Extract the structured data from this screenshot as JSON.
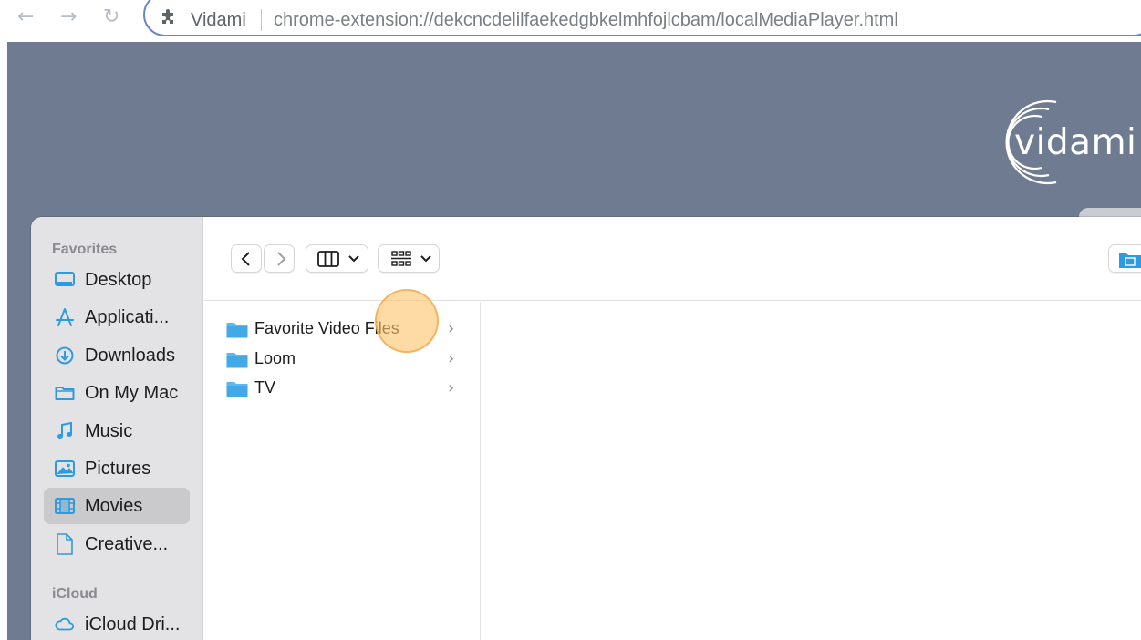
{
  "browser": {
    "extension_name": "Vidami",
    "url": "chrome-extension://dekcncdelilfaekedgbkelmhfojlcbam/localMediaPlayer.html",
    "icons": [
      "back-arrow-icon",
      "forward-arrow-icon",
      "reload-icon",
      "puzzle-extension-icon"
    ]
  },
  "page": {
    "logo_text": "vidami",
    "background_color": "#6f7b91"
  },
  "finder": {
    "sidebar": {
      "favorites_heading": "Favorites",
      "favorites": [
        {
          "label": "Desktop",
          "icon": "desktop-icon"
        },
        {
          "label": "Applicati...",
          "icon": "applications-icon"
        },
        {
          "label": "Downloads",
          "icon": "downloads-icon"
        },
        {
          "label": "On My Mac",
          "icon": "folder-icon"
        },
        {
          "label": "Music",
          "icon": "music-note-icon"
        },
        {
          "label": "Pictures",
          "icon": "photo-icon"
        },
        {
          "label": "Movies",
          "icon": "film-icon",
          "selected": true
        },
        {
          "label": "Creative...",
          "icon": "document-icon"
        }
      ],
      "icloud_heading": "iCloud",
      "icloud": [
        {
          "label": "iCloud Dri...",
          "icon": "cloud-icon"
        }
      ]
    },
    "toolbar": {
      "icons": [
        "chevron-left-icon",
        "chevron-right-icon",
        "column-view-icon",
        "grid-group-icon",
        "new-folder-icon"
      ]
    },
    "column_items": [
      {
        "label": "Favorite Video Files"
      },
      {
        "label": "Loom"
      },
      {
        "label": "TV"
      }
    ],
    "accent_color": "#2e9bde"
  },
  "click_highlight_color": "#fdc46e"
}
